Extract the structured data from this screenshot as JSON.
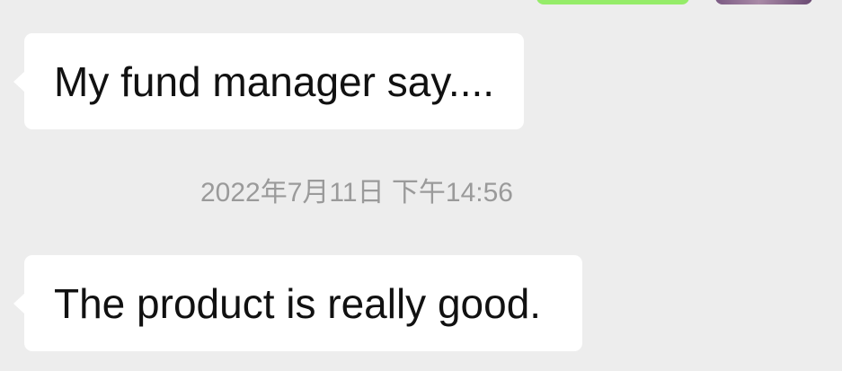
{
  "messages": [
    {
      "direction": "received",
      "text": "My fund manager say...."
    },
    {
      "direction": "received",
      "text": "The product is really good."
    }
  ],
  "timestamp": "2022年7月11日 下午14:56",
  "colors": {
    "background": "#ededed",
    "received_bubble": "#ffffff",
    "sent_bubble": "#95ec69",
    "timestamp_text": "#9a9a9a",
    "message_text": "#111111"
  }
}
